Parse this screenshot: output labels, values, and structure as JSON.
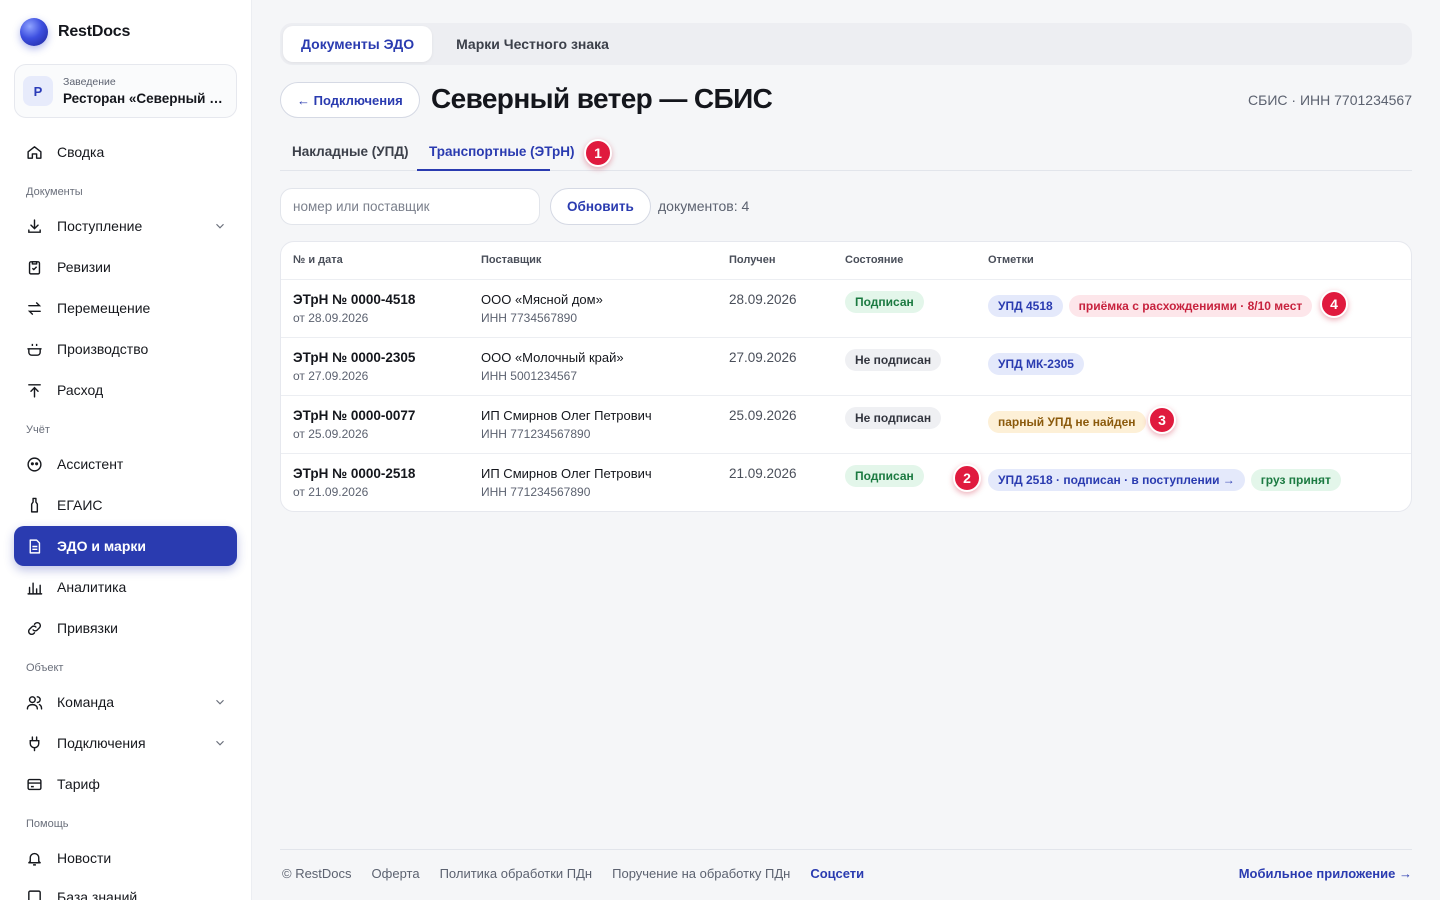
{
  "brand": {
    "name": "RestDocs"
  },
  "venue": {
    "avatar_letter": "Р",
    "caption": "Заведение",
    "name": "Ресторан «Северный ветер»"
  },
  "nav": {
    "summary": "Сводка",
    "section_docs": "Документы",
    "incoming": "Поступление",
    "audits": "Ревизии",
    "transfer": "Перемещение",
    "production": "Производство",
    "expense": "Расход",
    "section_accounting": "Учёт",
    "assistant": "Ассистент",
    "egais": "ЕГАИС",
    "edo": "ЭДО и марки",
    "analytics": "Аналитика",
    "bindings": "Привязки",
    "section_object": "Объект",
    "team": "Команда",
    "connections": "Подключения",
    "tariff": "Тариф",
    "section_help": "Помощь",
    "news": "Новости",
    "knowledge": "База знаний"
  },
  "main_tabs": {
    "edo": "Документы ЭДО",
    "marks": "Марки Честного знака"
  },
  "header": {
    "back_label": "← Подключения",
    "title": "Северный ветер — СБИС",
    "meta": "СБИС · ИНН 7701234567"
  },
  "subtabs": {
    "upd": "Накладные (УПД)",
    "etrn": "Транспортные (ЭТрН)"
  },
  "markers": {
    "m1": "1",
    "m2": "2",
    "m3": "3",
    "m4": "4"
  },
  "toolbar": {
    "search_placeholder": "номер или поставщик",
    "refresh_label": "Обновить",
    "count": "документов: 4"
  },
  "table": {
    "columns": {
      "num": "№ и дата",
      "supplier": "Поставщик",
      "received": "Получен",
      "state": "Состояние",
      "marks": "Отметки"
    },
    "rows": [
      {
        "num": "ЭТрН № 0000-4518",
        "date": "от 28.09.2026",
        "supplier": "ООО «Мясной дом»",
        "inn": "ИНН 7734567890",
        "received": "28.09.2026",
        "state": "Подписан",
        "mark1": "УПД 4518",
        "mark2": "приёмка с расхождениями · 8/10 мест"
      },
      {
        "num": "ЭТрН № 0000-2305",
        "date": "от 27.09.2026",
        "supplier": "ООО «Молочный край»",
        "inn": "ИНН 5001234567",
        "received": "27.09.2026",
        "state": "Не подписан",
        "mark1": "УПД МК-2305"
      },
      {
        "num": "ЭТрН № 0000-0077",
        "date": "от 25.09.2026",
        "supplier": "ИП Смирнов Олег Петрович",
        "inn": "ИНН 771234567890",
        "received": "25.09.2026",
        "state": "Не подписан",
        "mark1": "парный УПД не найден"
      },
      {
        "num": "ЭТрН № 0000-2518",
        "date": "от 21.09.2026",
        "supplier": "ИП Смирнов Олег Петрович",
        "inn": "ИНН 771234567890",
        "received": "21.09.2026",
        "state": "Подписан",
        "mark1": "УПД 2518 · подписан · в поступлении →",
        "mark2": "груз принят"
      }
    ]
  },
  "footer": {
    "copyright": "© RestDocs",
    "offer": "Оферта",
    "policy": "Политика обработки ПДн",
    "assignment": "Поручение на обработку ПДн",
    "social": "Соцсети",
    "mobile": "Мобильное приложение →"
  },
  "colors": {
    "accent": "#2a3bb0",
    "marker": "#e01a3e"
  }
}
